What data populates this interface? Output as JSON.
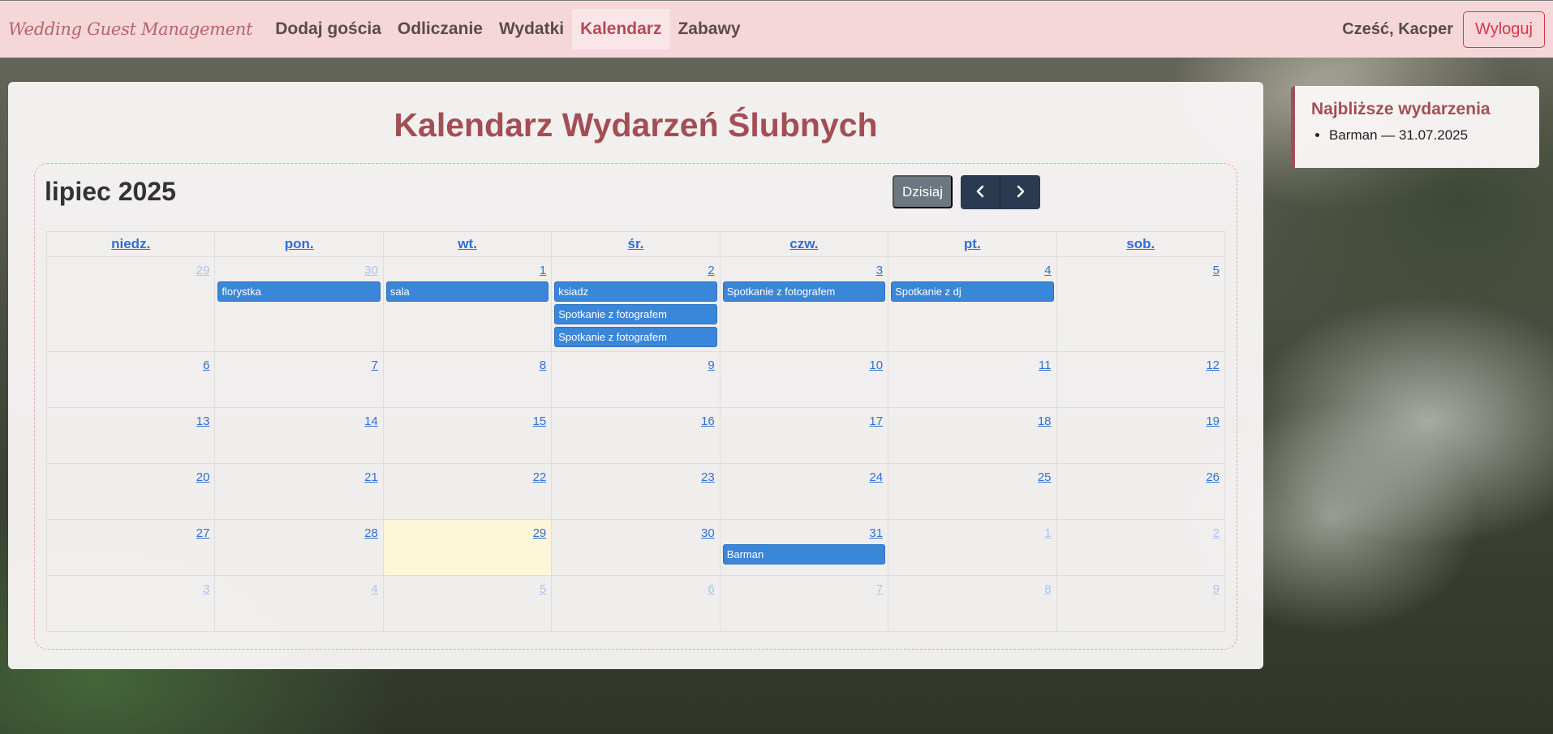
{
  "navbar": {
    "brand": "Wedding Guest Management",
    "links": [
      {
        "label": "Dodaj gościa",
        "active": false
      },
      {
        "label": "Odliczanie",
        "active": false
      },
      {
        "label": "Wydatki",
        "active": false
      },
      {
        "label": "Kalendarz",
        "active": true
      },
      {
        "label": "Zabawy",
        "active": false
      }
    ],
    "greeting": "Cześć, Kacper",
    "logout_label": "Wyloguj"
  },
  "main": {
    "title": "Kalendarz Wydarzeń Ślubnych",
    "calendar": {
      "month_label": "lipiec 2025",
      "today_label": "Dzisiaj",
      "prev_icon": "chevron-left-icon",
      "next_icon": "chevron-right-icon",
      "weekdays": [
        "niedz.",
        "pon.",
        "wt.",
        "śr.",
        "czw.",
        "pt.",
        "sob."
      ],
      "weeks": [
        [
          {
            "day": "29",
            "other": true,
            "events": []
          },
          {
            "day": "30",
            "other": true,
            "events": [
              "florystka"
            ]
          },
          {
            "day": "1",
            "other": false,
            "events": [
              "sala"
            ]
          },
          {
            "day": "2",
            "other": false,
            "events": [
              "ksiadz",
              "Spotkanie z fotografem",
              "Spotkanie z fotografem"
            ]
          },
          {
            "day": "3",
            "other": false,
            "events": [
              "Spotkanie z fotografem"
            ]
          },
          {
            "day": "4",
            "other": false,
            "events": [
              "Spotkanie z dj"
            ]
          },
          {
            "day": "5",
            "other": false,
            "events": []
          }
        ],
        [
          {
            "day": "6",
            "other": false,
            "events": []
          },
          {
            "day": "7",
            "other": false,
            "events": []
          },
          {
            "day": "8",
            "other": false,
            "events": []
          },
          {
            "day": "9",
            "other": false,
            "events": []
          },
          {
            "day": "10",
            "other": false,
            "events": []
          },
          {
            "day": "11",
            "other": false,
            "events": []
          },
          {
            "day": "12",
            "other": false,
            "events": []
          }
        ],
        [
          {
            "day": "13",
            "other": false,
            "events": []
          },
          {
            "day": "14",
            "other": false,
            "events": []
          },
          {
            "day": "15",
            "other": false,
            "events": []
          },
          {
            "day": "16",
            "other": false,
            "events": []
          },
          {
            "day": "17",
            "other": false,
            "events": []
          },
          {
            "day": "18",
            "other": false,
            "events": []
          },
          {
            "day": "19",
            "other": false,
            "events": []
          }
        ],
        [
          {
            "day": "20",
            "other": false,
            "events": []
          },
          {
            "day": "21",
            "other": false,
            "events": []
          },
          {
            "day": "22",
            "other": false,
            "events": []
          },
          {
            "day": "23",
            "other": false,
            "events": []
          },
          {
            "day": "24",
            "other": false,
            "events": []
          },
          {
            "day": "25",
            "other": false,
            "events": []
          },
          {
            "day": "26",
            "other": false,
            "events": []
          }
        ],
        [
          {
            "day": "27",
            "other": false,
            "events": []
          },
          {
            "day": "28",
            "other": false,
            "events": []
          },
          {
            "day": "29",
            "other": false,
            "today": true,
            "events": []
          },
          {
            "day": "30",
            "other": false,
            "events": []
          },
          {
            "day": "31",
            "other": false,
            "events": [
              "Barman"
            ]
          },
          {
            "day": "1",
            "other": true,
            "events": []
          },
          {
            "day": "2",
            "other": true,
            "events": []
          }
        ],
        [
          {
            "day": "3",
            "other": true,
            "events": []
          },
          {
            "day": "4",
            "other": true,
            "events": []
          },
          {
            "day": "5",
            "other": true,
            "events": []
          },
          {
            "day": "6",
            "other": true,
            "events": []
          },
          {
            "day": "7",
            "other": true,
            "events": []
          },
          {
            "day": "8",
            "other": true,
            "events": []
          },
          {
            "day": "9",
            "other": true,
            "events": []
          }
        ]
      ]
    }
  },
  "sidebar": {
    "title": "Najbliższe wydarzenia",
    "items": [
      "Barman — 31.07.2025"
    ]
  },
  "colors": {
    "navbar_bg": "#f5d6d9",
    "accent": "#a34e55",
    "event_bg": "#3a86d9",
    "today_bg": "#fdf6d8",
    "logout": "#d9394a"
  }
}
